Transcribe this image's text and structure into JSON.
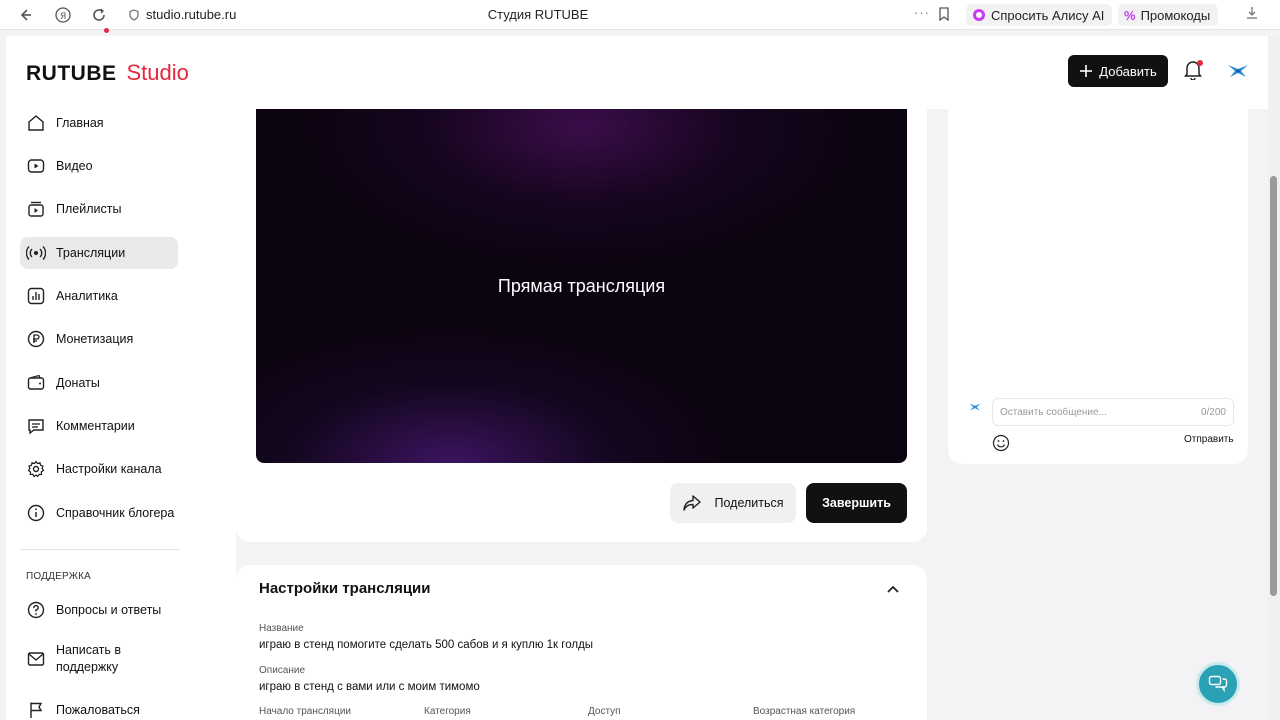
{
  "browser": {
    "url": "studio.rutube.ru",
    "title": "Студия RUTUBE",
    "alice_label": "Спросить Алису AI",
    "promo_label": "Промокоды"
  },
  "header": {
    "logo_brand": "RUTUBE",
    "logo_product": "Studio",
    "add_label": "Добавить"
  },
  "sidebar": {
    "items": [
      {
        "label": "Главная",
        "icon": "home-icon"
      },
      {
        "label": "Видео",
        "icon": "video-icon"
      },
      {
        "label": "Плейлисты",
        "icon": "playlist-icon"
      },
      {
        "label": "Трансляции",
        "icon": "broadcast-icon",
        "active": true
      },
      {
        "label": "Аналитика",
        "icon": "analytics-icon"
      },
      {
        "label": "Монетизация",
        "icon": "monetization-icon"
      },
      {
        "label": "Донаты",
        "icon": "donations-icon"
      },
      {
        "label": "Комментарии",
        "icon": "comments-icon"
      },
      {
        "label": "Настройки канала",
        "icon": "settings-icon"
      },
      {
        "label": "Справочник блогера",
        "icon": "info-icon"
      }
    ],
    "support_heading": "ПОДДЕРЖКА",
    "support_items": [
      {
        "label": "Вопросы и ответы",
        "icon": "question-icon"
      },
      {
        "label": "Написать в поддержку",
        "icon": "mail-icon"
      },
      {
        "label": "Пожаловаться",
        "icon": "flag-icon"
      }
    ]
  },
  "player": {
    "overlay_text": "Прямая трансляция",
    "share_label": "Поделиться",
    "finish_label": "Завершить"
  },
  "settings": {
    "title": "Настройки трансляции",
    "name_label": "Название",
    "name_value": "играю в стенд помогите сделать 500 сабов и я куплю 1к голды",
    "description_label": "Описание",
    "description_value": "играю в стенд с вами или с моим тимомо",
    "start_label": "Начало трансляции",
    "category_label": "Категория",
    "access_label": "Доступ",
    "age_label": "Возрастная категория"
  },
  "chat": {
    "placeholder": "Оставить сообщение...",
    "counter": "0/200",
    "send_label": "Отправить"
  },
  "colors": {
    "accent": "#e6273e",
    "primary_button": "#111111",
    "help_fab": "#2aa1b4"
  }
}
